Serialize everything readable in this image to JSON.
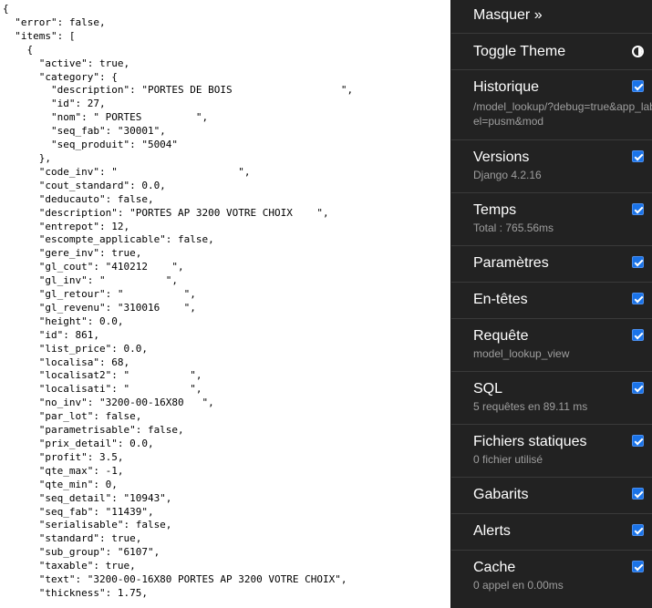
{
  "json_response_text": "{\n  \"error\": false,\n  \"items\": [\n    {\n      \"active\": true,\n      \"category\": {\n        \"description\": \"PORTES DE BOIS                  \",\n        \"id\": 27,\n        \"nom\": \" PORTES         \",\n        \"seq_fab\": \"30001\",\n        \"seq_produit\": \"5004\"\n      },\n      \"code_inv\": \"                    \",\n      \"cout_standard\": 0.0,\n      \"deducauto\": false,\n      \"description\": \"PORTES AP 3200 VOTRE CHOIX    \",\n      \"entrepot\": 12,\n      \"escompte_applicable\": false,\n      \"gere_inv\": true,\n      \"gl_cout\": \"410212    \",\n      \"gl_inv\": \"          \",\n      \"gl_retour\": \"          \",\n      \"gl_revenu\": \"310016    \",\n      \"height\": 0.0,\n      \"id\": 861,\n      \"list_price\": 0.0,\n      \"localisa\": 68,\n      \"localisat2\": \"          \",\n      \"localisati\": \"          \",\n      \"no_inv\": \"3200-00-16X80   \",\n      \"par_lot\": false,\n      \"parametrisable\": false,\n      \"prix_detail\": 0.0,\n      \"profit\": 3.5,\n      \"qte_max\": -1,\n      \"qte_min\": 0,\n      \"seq_detail\": \"10943\",\n      \"seq_fab\": \"11439\",\n      \"serialisable\": false,\n      \"standard\": true,\n      \"sub_group\": \"6107\",\n      \"taxable\": true,\n      \"text\": \"3200-00-16X80 PORTES AP 3200 VOTRE CHOIX\",\n      \"thickness\": 1.75,",
  "toolbar": {
    "hide_label": "Masquer »",
    "theme_label": "Toggle Theme",
    "theme_icon": "half-circle-icon",
    "check_color": "#1a73e8",
    "background": "#222222",
    "panels": [
      {
        "id": "historique",
        "title": "Historique",
        "subtitle": "/model_lookup/?debug=true&app_label=pusm&mod",
        "checked": true
      },
      {
        "id": "versions",
        "title": "Versions",
        "subtitle": "Django 4.2.16",
        "checked": true
      },
      {
        "id": "temps",
        "title": "Temps",
        "subtitle": "Total : 765.56ms",
        "checked": true
      },
      {
        "id": "parametres",
        "title": "Paramètres",
        "subtitle": "",
        "checked": true
      },
      {
        "id": "en-tetes",
        "title": "En-têtes",
        "subtitle": "",
        "checked": true
      },
      {
        "id": "requete",
        "title": "Requête",
        "subtitle": "model_lookup_view",
        "checked": true
      },
      {
        "id": "sql",
        "title": "SQL",
        "subtitle": "5 requêtes en 89.11 ms",
        "checked": true
      },
      {
        "id": "fichiers-statiques",
        "title": "Fichiers statiques",
        "subtitle": "0 fichier utilisé",
        "checked": true
      },
      {
        "id": "gabarits",
        "title": "Gabarits",
        "subtitle": "",
        "checked": true
      },
      {
        "id": "alerts",
        "title": "Alerts",
        "subtitle": "",
        "checked": true
      },
      {
        "id": "cache",
        "title": "Cache",
        "subtitle": "0 appel en 0.00ms",
        "checked": true
      }
    ]
  }
}
